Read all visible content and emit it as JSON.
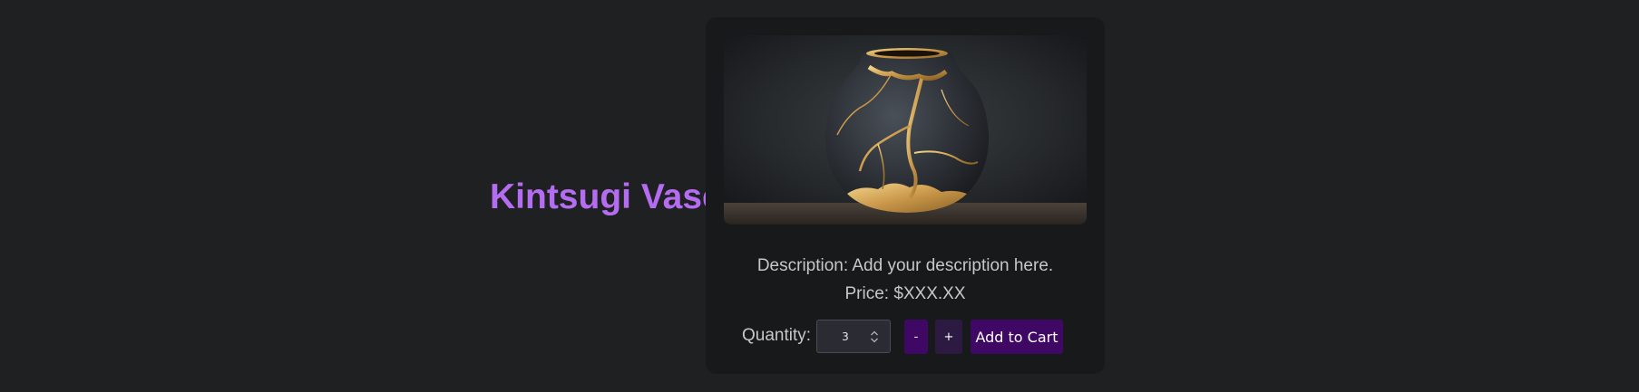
{
  "product": {
    "title": "Kintsugi Vase",
    "image_alt": "kintsugi vase image",
    "description": "Description: Add your description here.",
    "price": "Price: $XXX.XX"
  },
  "quantity": {
    "label": "Quantity:",
    "value": "3",
    "minus_label": "-",
    "plus_label": "+"
  },
  "cart": {
    "add_label": "Add to Cart"
  },
  "colors": {
    "page_background": "#1f2022",
    "card_background": "#18191b",
    "title": "#b46cf0",
    "button_primary": "#3e0864",
    "button_secondary": "#2c1a42"
  }
}
